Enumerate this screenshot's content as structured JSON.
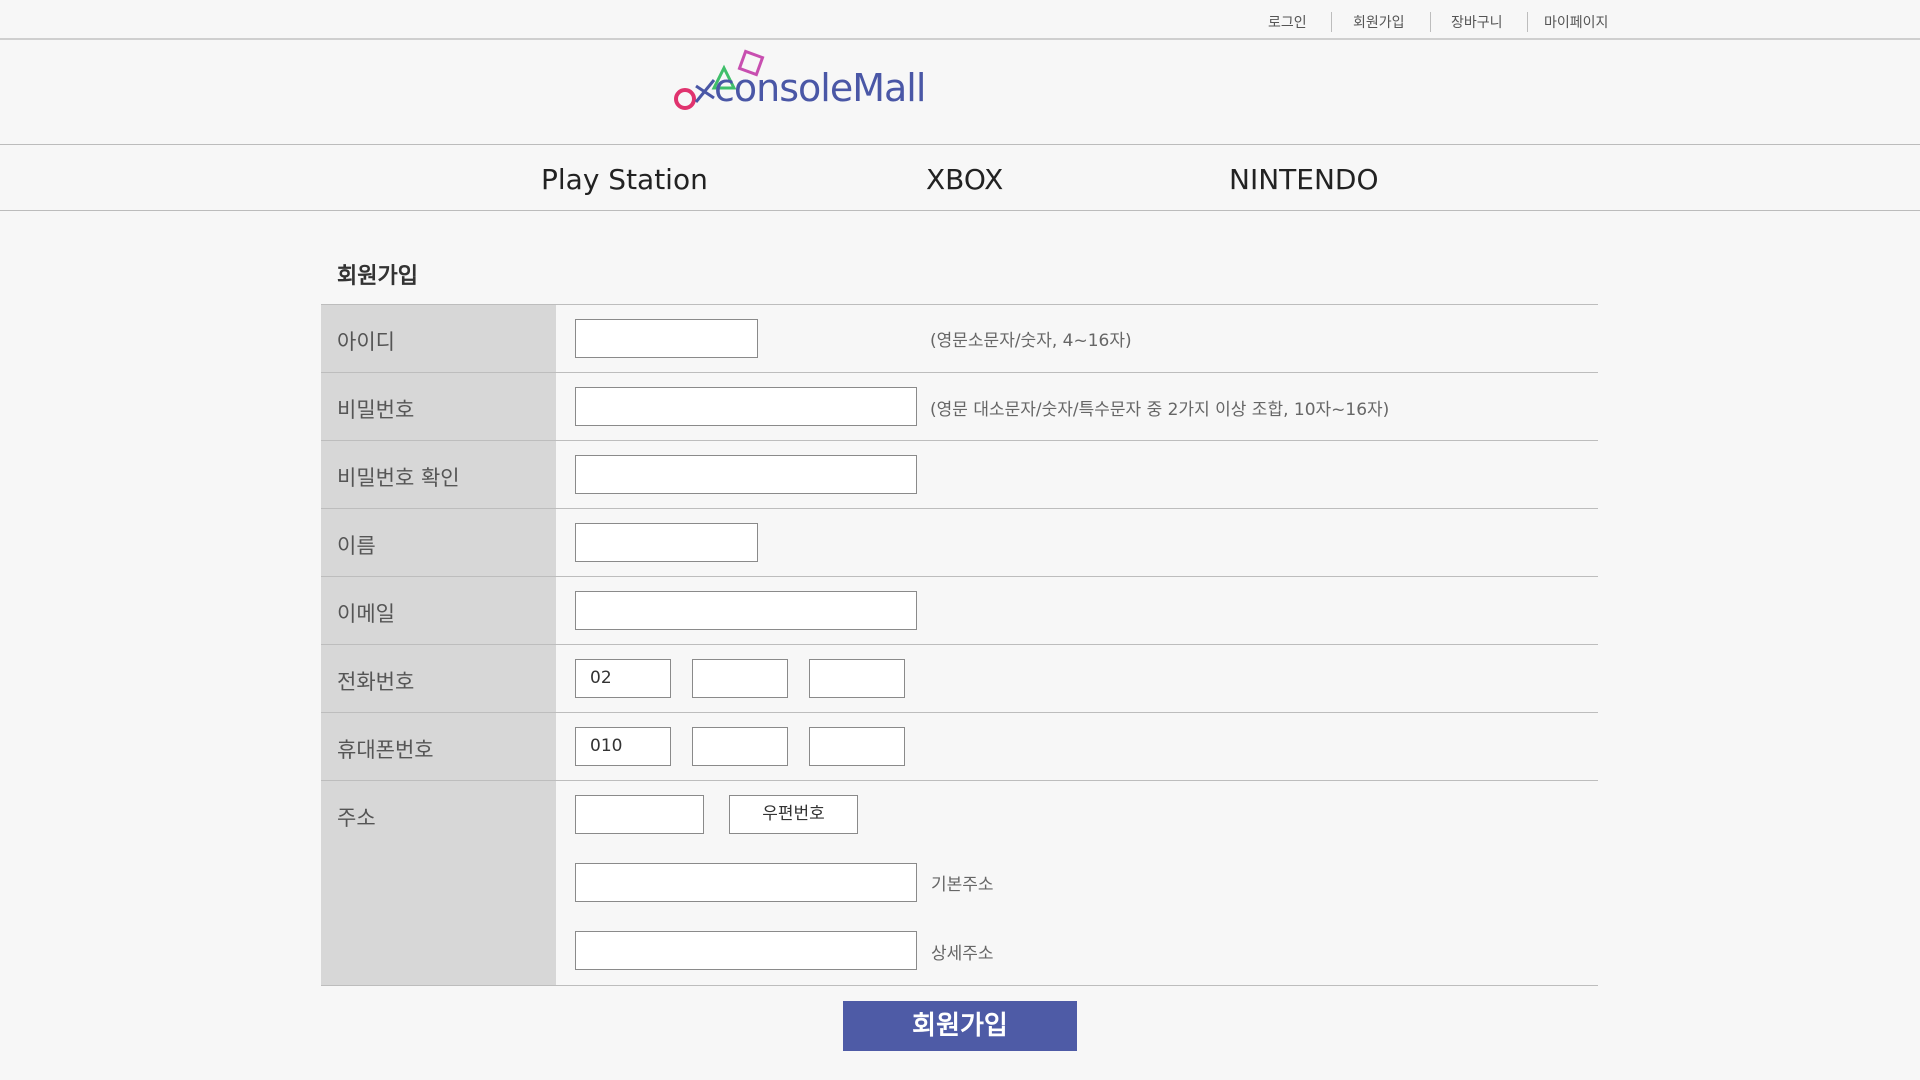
{
  "topbar": {
    "login": "로그인",
    "signup": "회원가입",
    "cart": "장바구니",
    "mypage": "마이페이지"
  },
  "logo": {
    "brand": "consoleMall",
    "colors": {
      "circle": "#e0336e",
      "cross": "#4a57a6",
      "triangle": "#3fbf6a",
      "square": "#c84fb0"
    }
  },
  "nav": {
    "items": [
      "Play Station",
      "XBOX",
      "NINTENDO"
    ]
  },
  "form": {
    "title": "회원가입",
    "labels": {
      "id": "아이디",
      "password": "비밀번호",
      "password_confirm": "비밀번호 확인",
      "name": "이름",
      "email": "이메일",
      "phone": "전화번호",
      "mobile": "휴대폰번호",
      "address": "주소"
    },
    "hints": {
      "id": "(영문소문자/숫자, 4~16자)",
      "password": "(영문 대소문자/숫자/특수문자 중 2가지 이상 조합, 10자~16자)",
      "base_address": "기본주소",
      "detail_address": "상세주소"
    },
    "values": {
      "phone_prefix": "02",
      "mobile_prefix": "010"
    },
    "zip_button": "우편번호",
    "submit": "회원가입"
  },
  "colors": {
    "accent": "#4e5ba6",
    "label_bg": "#d7d7d7",
    "page_bg": "#f7f7f7"
  }
}
